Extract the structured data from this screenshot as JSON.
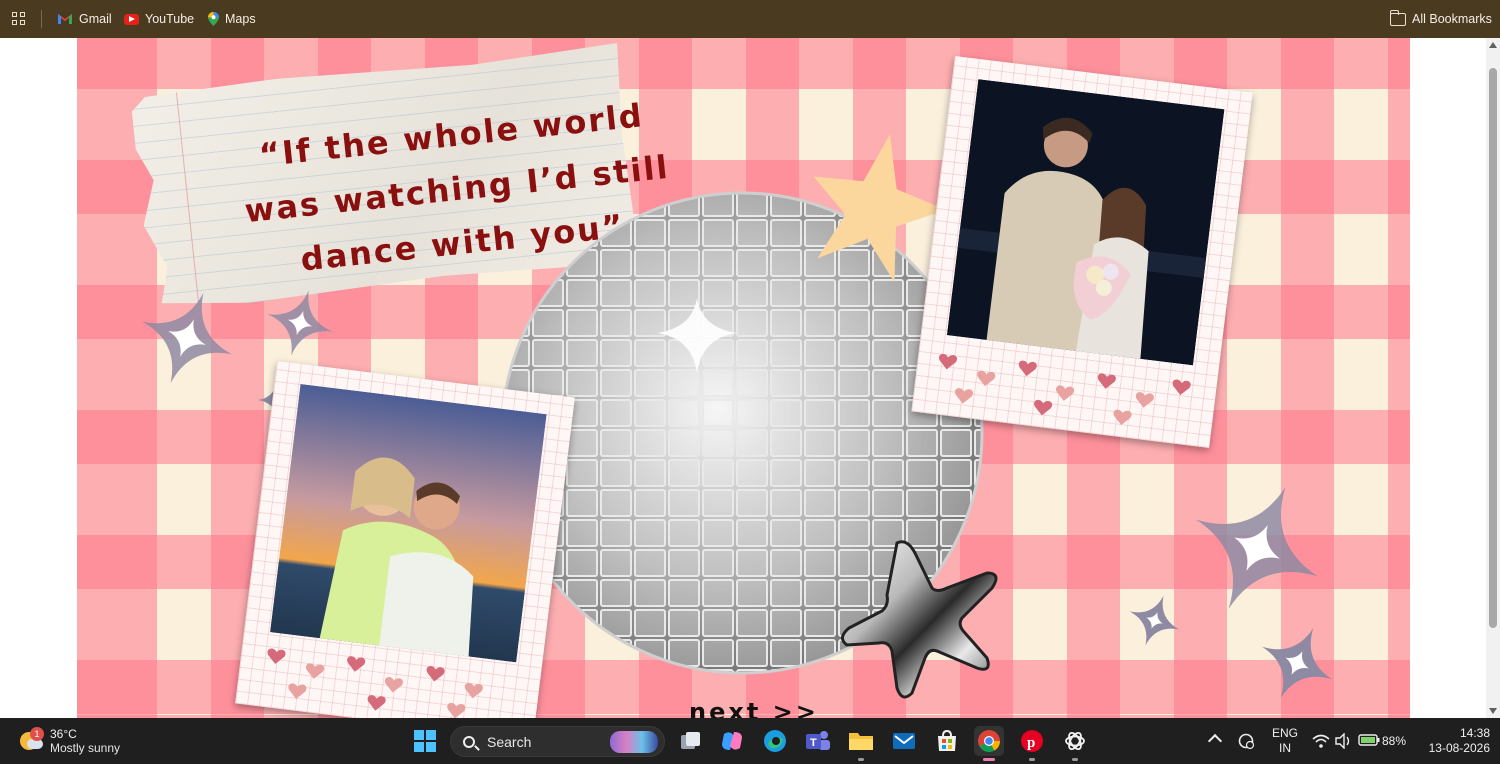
{
  "bookmarks": {
    "items": [
      {
        "label": "Gmail"
      },
      {
        "label": "YouTube"
      },
      {
        "label": "Maps"
      }
    ],
    "all_bookmarks": "All Bookmarks"
  },
  "page": {
    "quote": "“If the whole world was watching I’d still dance with you”",
    "next_link": "next >>"
  },
  "taskbar": {
    "weather": {
      "badge": "1",
      "temp": "36°C",
      "condition": "Mostly sunny"
    },
    "search_label": "Search",
    "language": {
      "line1": "ENG",
      "line2": "IN"
    },
    "battery": "88%",
    "time": "14:38",
    "date": "13-08-2026"
  },
  "colors": {
    "bookmarks_bar": "#4a3a20",
    "gingham_pink": "#ff7890",
    "gingham_cream": "#fbf0dc",
    "quote_text": "#8a1010",
    "taskbar": "#1f1f1f"
  }
}
